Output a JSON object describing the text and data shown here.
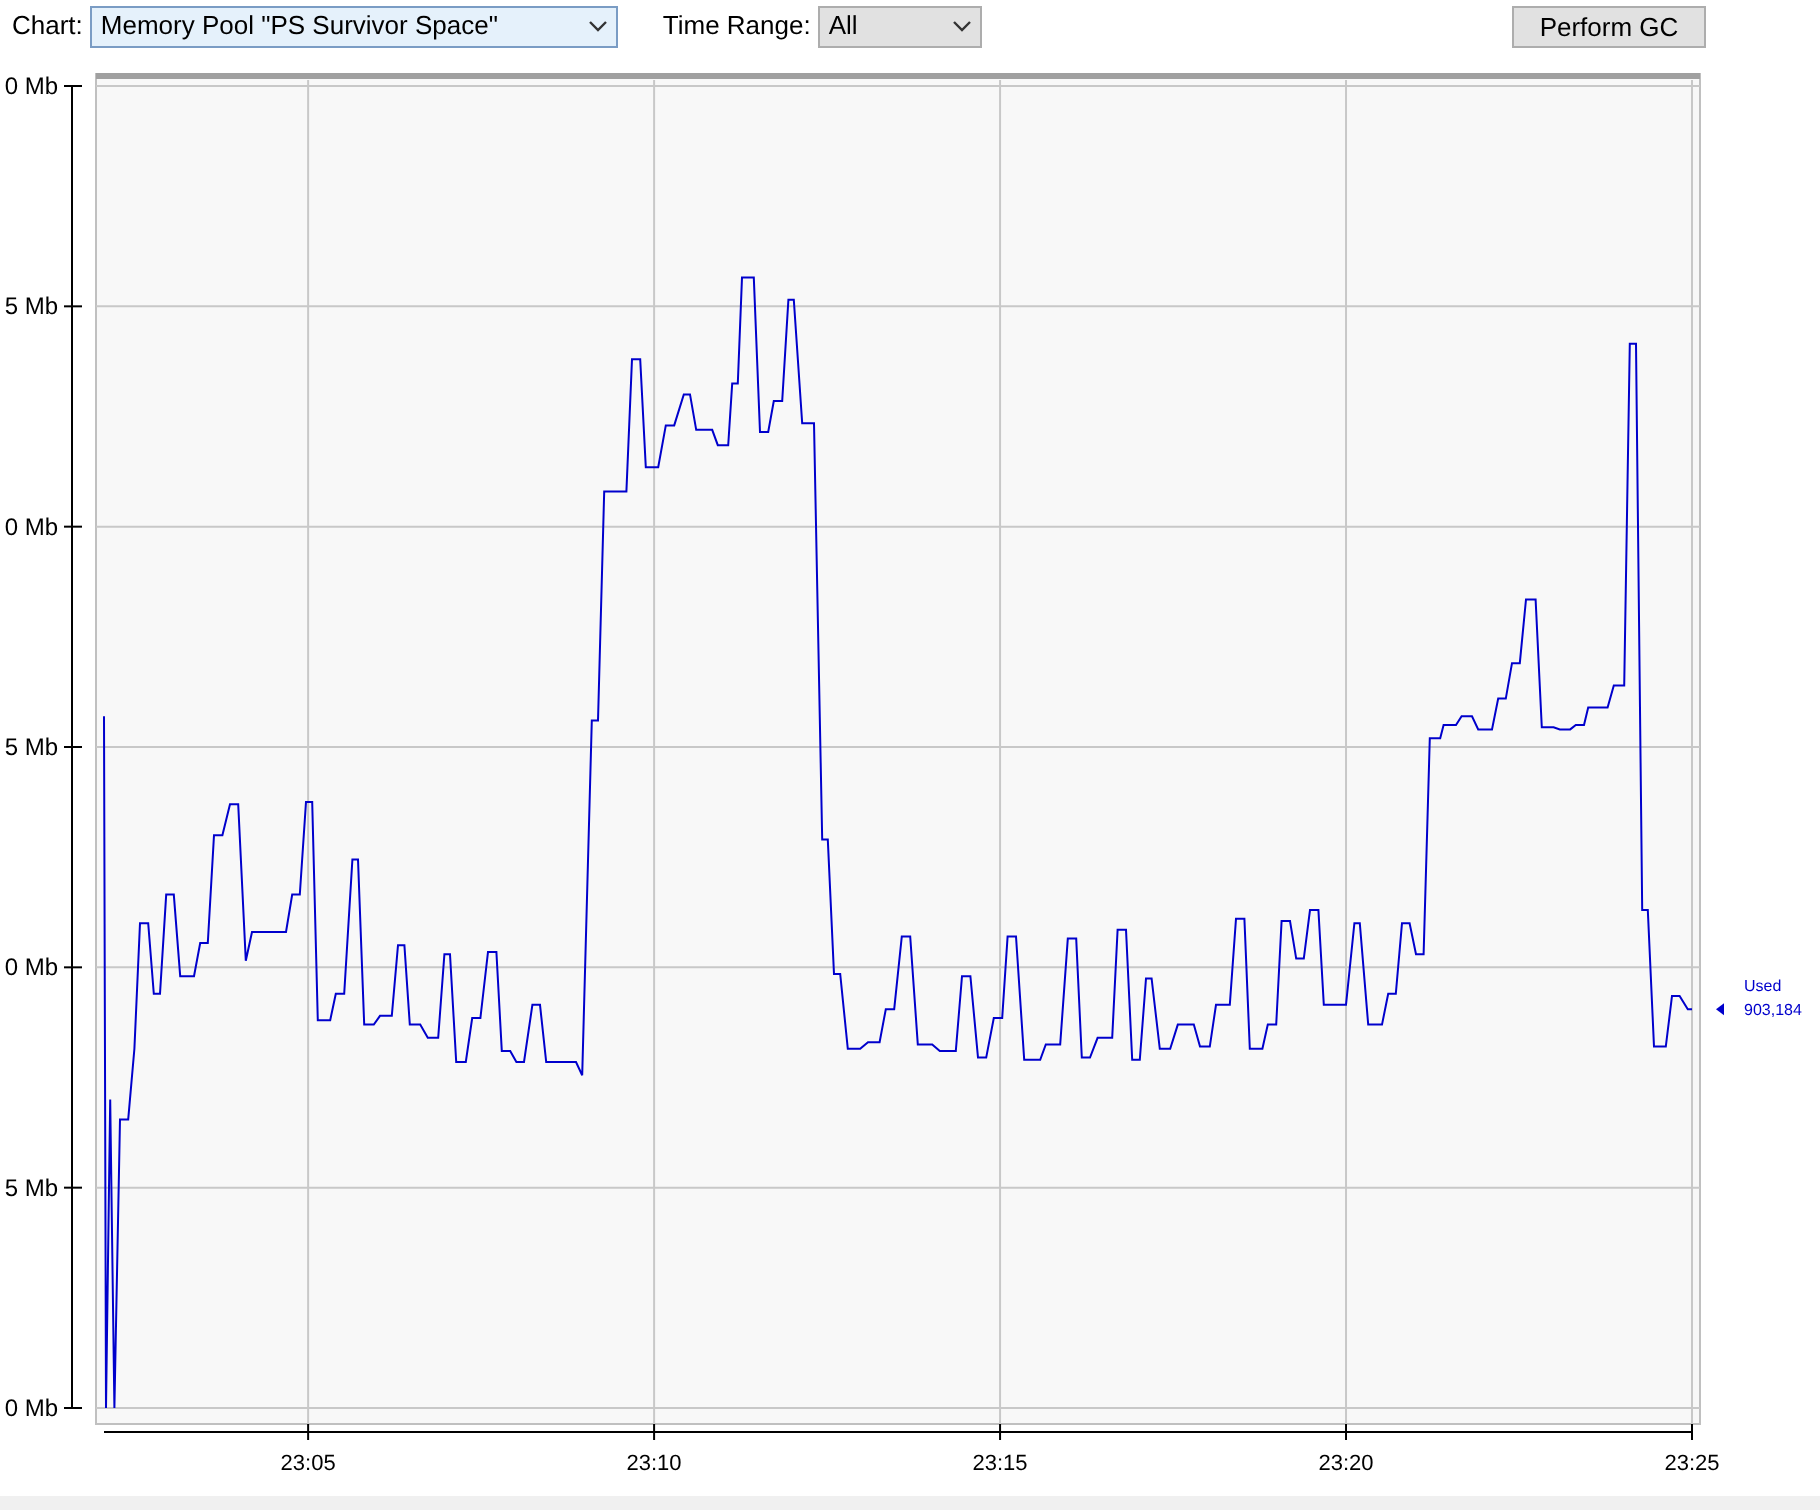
{
  "toolbar": {
    "chart_label": "Chart:",
    "chart_select": {
      "value": "Memory Pool \"PS Survivor Space\""
    },
    "time_range_label": "Time Range:",
    "time_range_select": {
      "value": "All"
    },
    "perform_gc_button": "Perform GC"
  },
  "chart": {
    "y_axis_labels": [
      "0 Mb",
      "5 Mb",
      "0 Mb",
      "5 Mb",
      "0 Mb",
      "5 Mb",
      "0 Mb"
    ],
    "x_axis_labels": [
      "23:05",
      "23:10",
      "23:15",
      "23:20",
      "23:25"
    ],
    "legend": {
      "series_name": "Used",
      "current_value": "903,184"
    }
  }
}
